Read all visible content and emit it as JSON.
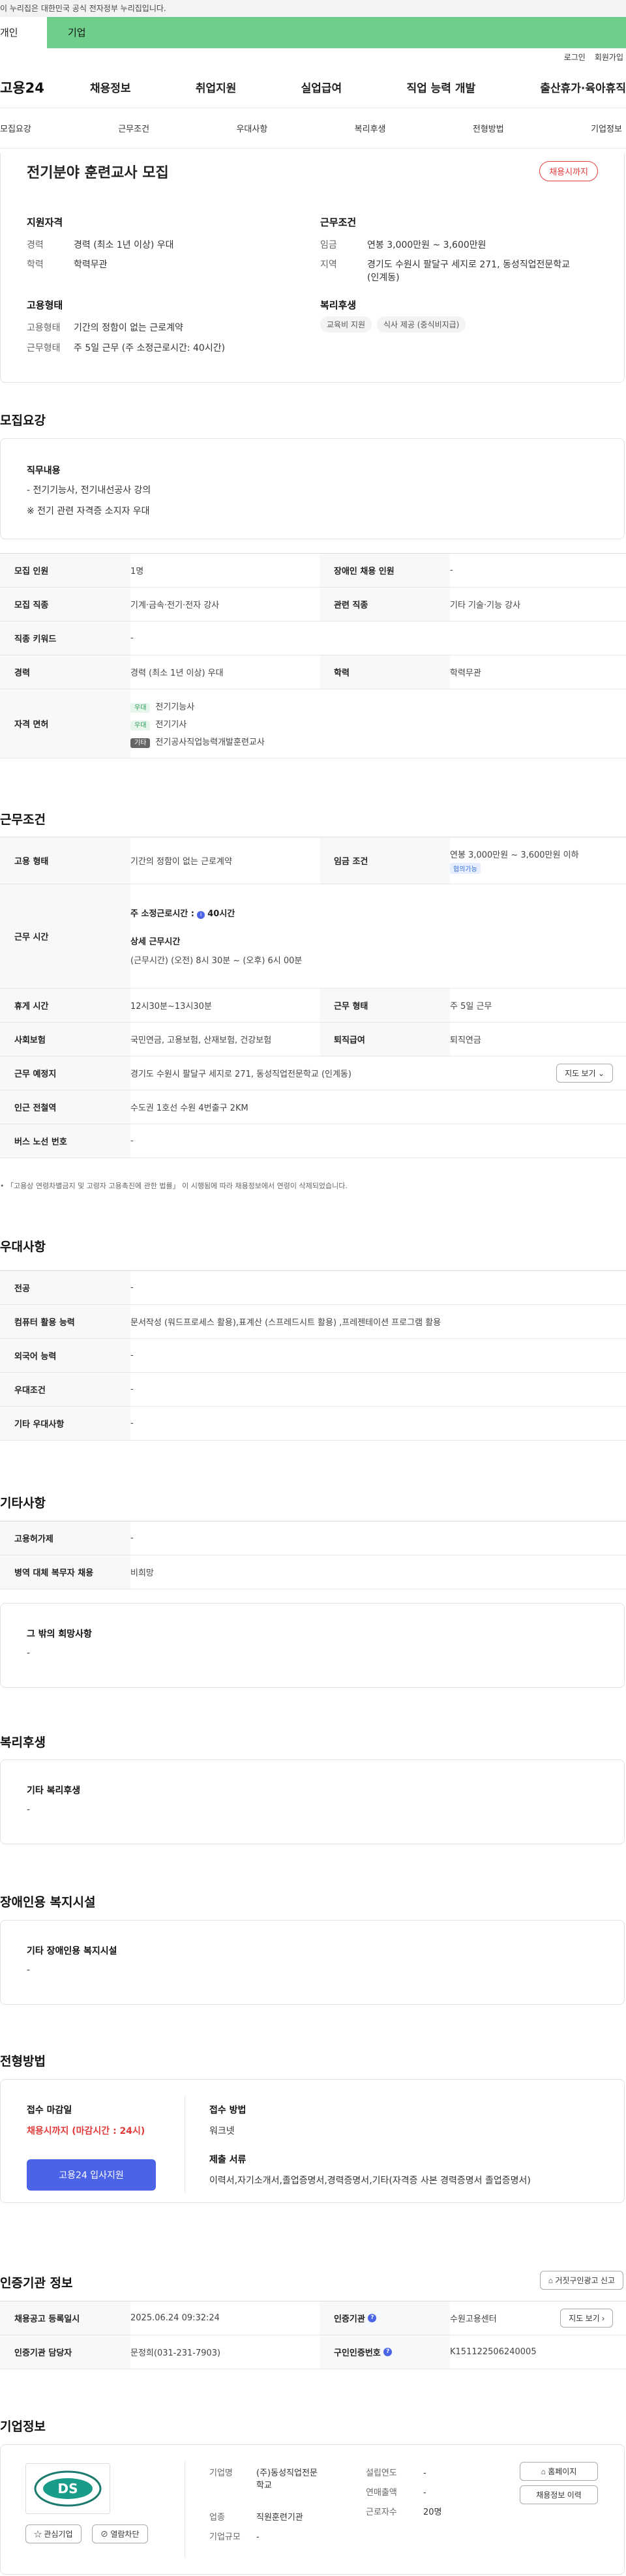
{
  "gov_banner": "이 누리집은 대한민국 공식 전자정부 누리집입니다.",
  "user_tabs": [
    "개인",
    "기업"
  ],
  "util": [
    "로그인",
    "회원가입"
  ],
  "logo": "고용24",
  "gnb": [
    "채용정보",
    "취업지원",
    "실업급여",
    "직업 능력 개발",
    "출산휴가·육아휴직"
  ],
  "subtabs": [
    "모집요강",
    "근무조건",
    "우대사항",
    "복리후생",
    "전형방법",
    "기업정보"
  ],
  "top": {
    "title": "전기분야 훈련교사 모집",
    "status": "채용시까지",
    "qual_h": "지원자격",
    "career_k": "경력",
    "career_v": "경력 (최소 1년 이상) 우대",
    "edu_k": "학력",
    "edu_v": "학력무관",
    "emp_h": "고용형태",
    "emp_k": "고용형태",
    "emp_v": "기간의 정함이 없는 근로계약",
    "form_k": "근무형태",
    "form_v": "주 5일 근무 (주 소정근로시간: 40시간)",
    "cond_h": "근무조건",
    "wage_k": "임금",
    "wage_v": "연봉 3,000만원 ~ 3,600만원",
    "area_k": "지역",
    "area_v": "경기도 수원시 팔달구 세지로 271, 동성직업전문학교 (인계동)",
    "welfare_h": "복리후생",
    "welfare_chips": [
      "교육비 지원",
      "식사 제공 (중식비지급)"
    ]
  },
  "recruit": {
    "title": "모집요강",
    "duty_h": "직무내용",
    "duty_1": "- 전기기능사, 전기내선공사 강의",
    "duty_2": "※ 전기 관련 자격증 소지자 우대",
    "rows": [
      {
        "th": "모집 인원",
        "td": "1명",
        "th2": "장애인 채용 인원",
        "td2": "-"
      },
      {
        "th": "모집 직종",
        "td": "기계·금속·전기·전자 강사",
        "th2": "관련 직종",
        "td2": "기타 기술·기능 강사"
      },
      {
        "th": "직종 키워드",
        "td": "-"
      },
      {
        "th": "경력",
        "td": "경력 (최소 1년 이상) 우대",
        "th2": "학력",
        "td2": "학력무관"
      }
    ],
    "license_th": "자격 면허",
    "licenses": [
      {
        "tag": "우대",
        "name": "전기기능사"
      },
      {
        "tag": "우대",
        "name": "전기기사"
      },
      {
        "tag": "기타",
        "name": "전기공사직업능력개발훈련교사"
      }
    ]
  },
  "work": {
    "title": "근무조건",
    "type_th": "고용 형태",
    "type_td": "기간의 정함이 없는 근로계약",
    "wage_th": "임금 조건",
    "wage_td": "연봉 3,000만원 ~ 3,600만원 이하",
    "wage_badge": "협의가능",
    "time_th": "근무 시간",
    "time_1": "주 소정근로시간 :",
    "time_1b": "40시간",
    "time_2": "상세 근무시간",
    "time_3": "(근무시간) (오전) 8시 30분 ~ (오후) 6시 00분",
    "rest_th": "휴게 시간",
    "rest_td": "12시30분~13시30분",
    "wtype_th": "근무 형태",
    "wtype_td": "주 5일 근무",
    "ins_th": "사회보험",
    "ins_td": "국민연금, 고용보험, 산재보험, 건강보험",
    "ret_th": "퇴직급여",
    "ret_td": "퇴직연금",
    "place_th": "근무 예정지",
    "place_td": "경기도 수원시 팔달구 세지로 271, 동성직업전문학교 (인계동)",
    "map_btn": "지도 보기",
    "sub_th": "인근 전철역",
    "sub_td": "수도권 1호선 수원 4번출구 2KM",
    "bus_th": "버스 노선 번호",
    "bus_td": "-",
    "note": "「고용상 연령차별금지 및 고령자 고용촉진에 관한 법률」 이 시행됨에 따라 채용정보에서 연령이 삭제되었습니다."
  },
  "pref": {
    "title": "우대사항",
    "rows": [
      {
        "th": "전공",
        "td": "-"
      },
      {
        "th": "컴퓨터 활용 능력",
        "td": "문서작성 (워드프로세스 활용),표계산 (스프레드시트 활용) ,프레젠테이션 프로그램 활용"
      },
      {
        "th": "외국어 능력",
        "td": "-"
      },
      {
        "th": "우대조건",
        "td": "-"
      },
      {
        "th": "기타 우대사항",
        "td": "-"
      }
    ]
  },
  "etc": {
    "title": "기타사항",
    "rows": [
      {
        "th": "고용허가제",
        "td": "-"
      },
      {
        "th": "병역 대체 복무자 채용",
        "td": "비희망"
      }
    ],
    "wish_h": "그 밖의 희망사항",
    "wish_v": "-"
  },
  "welfare": {
    "title": "복리후생",
    "h": "기타 복리후생",
    "v": "-"
  },
  "disab": {
    "title": "장애인용 복지시설",
    "h": "기타 장애인용 복지시설",
    "v": "-"
  },
  "screen": {
    "title": "전형방법",
    "deadline_h": "접수 마감일",
    "deadline_v": "채용시까지 (마감시간 : 24시)",
    "apply_btn": "고용24 입사지원",
    "method_h": "접수 방법",
    "method_v": "워크넷",
    "doc_h": "제출 서류",
    "doc_v": "이력서,자기소개서,졸업증명서,경력증명서,기타(자격증 사본 경력증명서 졸업증명서)"
  },
  "agency": {
    "title": "인증기관 정보",
    "report_btn": "거짓구인광고 신고",
    "reg_th": "채용공고 등록일시",
    "reg_td": "2025.06.24 09:32:24",
    "org_th": "인증기관",
    "org_td": "수원고용센터",
    "map_btn": "지도 보기",
    "mgr_th": "인증기관 담당자",
    "mgr_td": "문정희(031-231-7903)",
    "no_th": "구인인증번호",
    "no_td": "K151122506240005"
  },
  "company": {
    "title": "기업정보",
    "fav_btn": "관심기업",
    "block_btn": "열람차단",
    "home_btn": "홈페이지",
    "hist_btn": "채용정보 이력",
    "name_k": "기업명",
    "name_v": "(주)동성직업전문학교",
    "ind_k": "업종",
    "ind_v": "직원훈련기관",
    "scale_k": "기업규모",
    "scale_v": "-",
    "est_k": "설립연도",
    "est_v": "-",
    "sales_k": "연매출액",
    "sales_v": "-",
    "emp_k": "근로자수",
    "emp_v": "20명",
    "logo_text": "DS"
  },
  "colors": {
    "accent": "#4a63e7",
    "red": "#e23b3b",
    "green": "#6fce8c"
  }
}
